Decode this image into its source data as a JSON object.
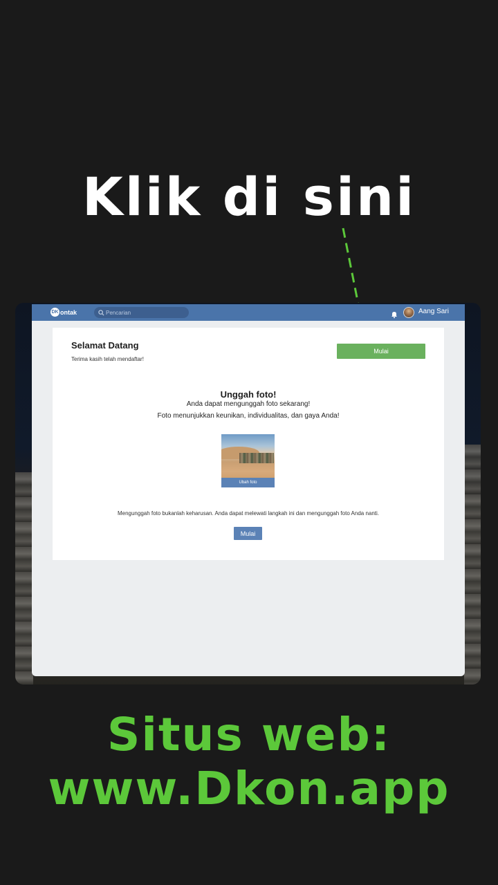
{
  "overlay": {
    "headline": "Klik di sini",
    "footer_line1": "Situs web:",
    "footer_line2": "www.Dkon.app",
    "headline_color": "#ffffff",
    "footer_color": "#5cc83a",
    "arrow_color": "#5cc83a"
  },
  "app": {
    "logo_mark": "DK",
    "logo_text": "ontak",
    "search_placeholder": "Pencarian",
    "user_name": "Aang Sari",
    "brand_color": "#4a74aa"
  },
  "welcome": {
    "title": "Selamat Datang",
    "subtitle": "Terima kasih telah mendaftar!",
    "start_button": "Mulai",
    "start_button_color": "#6ab15e"
  },
  "upload": {
    "title": "Unggah foto!",
    "line1": "Anda dapat mengunggah foto sekarang!",
    "line2": "Foto menunjukkan keunikan, individualitas, dan gaya Anda!",
    "change_photo_label": "Ubah foto",
    "note": "Mengunggah foto bukanlah keharusan. Anda dapat melewati langkah ini dan mengunggah foto Anda nanti.",
    "start_button": "Mulai"
  }
}
